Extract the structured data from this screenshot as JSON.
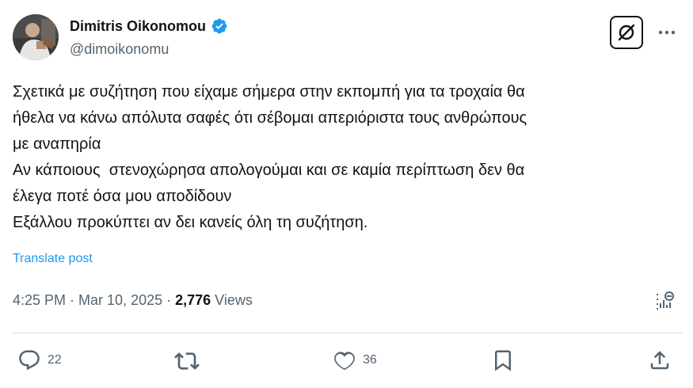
{
  "author": {
    "display_name": "Dimitris Oikonomou",
    "handle": "@dimoikonomu",
    "verified": true,
    "verified_color": "#1d9bf0"
  },
  "post": {
    "lines": [
      "Σχετικά με συζήτηση που είχαμε σήμερα στην εκπομπή για τα τροχαία θα",
      "ήθελα να κάνω απόλυτα σαφές ότι σέβομαι απεριόριστα τους ανθρώπους",
      "με αναπηρία",
      "Αν κάποιους  στενοχώρησα απολογούμαι και σε καμία περίπτωση δεν θα",
      "έλεγα ποτέ όσα μου αποδίδουν",
      "Εξάλλου προκύπτει αν δει κανείς όλη τη συζήτηση."
    ],
    "translate_label": "Translate post"
  },
  "meta": {
    "time": "4:25 PM",
    "date": "Mar 10, 2025",
    "separator": "·",
    "views_count": "2,776",
    "views_label": "Views"
  },
  "actions": {
    "replies": "22",
    "likes": "36"
  },
  "icons": {
    "grok": "grok-icon",
    "more": "more-icon",
    "analytics": "analytics-icon",
    "reply": "reply-icon",
    "repost": "repost-icon",
    "like": "like-icon",
    "bookmark": "bookmark-icon",
    "share": "share-icon"
  },
  "colors": {
    "text": "#0f1419",
    "secondary": "#536471",
    "link": "#1d9bf0",
    "divider": "#cfd9de"
  }
}
